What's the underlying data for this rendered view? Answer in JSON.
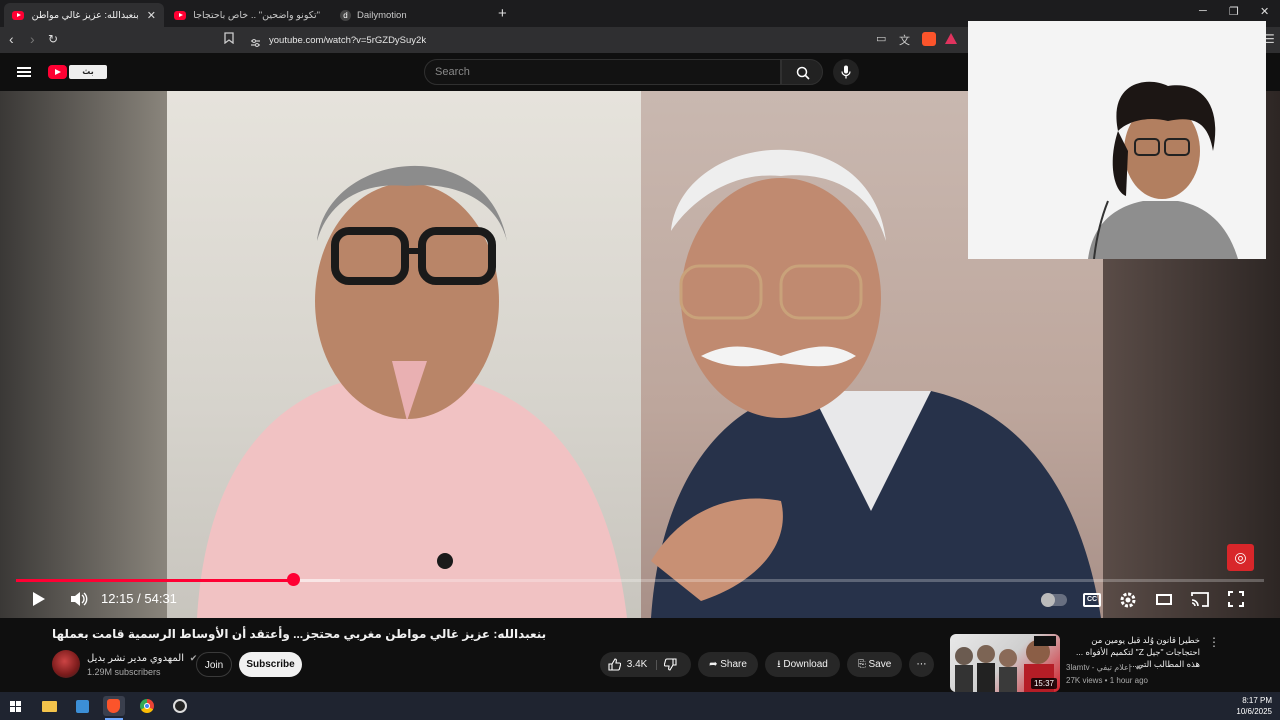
{
  "browser": {
    "tabs": [
      {
        "title": "بنعبدالله: عزيز غالي مواطن مغربي",
        "active": true,
        "site": "youtube"
      },
      {
        "title": "\"تكونو واضحين\" .. خاص باحتجاجات الشـ",
        "active": false,
        "site": "youtube"
      },
      {
        "title": "Dailymotion",
        "active": false,
        "site": "dailymotion"
      }
    ],
    "new_tab": "+",
    "url": "youtube.com/watch?v=5rGZDySuy2k"
  },
  "youtube": {
    "search_placeholder": "Search",
    "logo_badge": "بث",
    "player": {
      "time": "12:15 / 54:31",
      "progress": 0.2222,
      "buffered": 0.26
    },
    "video": {
      "title": "بنعبدالله: عزيز غالي مواطن مغربي محتجز... وأعتقد أن الأوساط الرسمية قامت بعملها",
      "channel": "المهدوي مدير نشر بديل",
      "subscribers": "1.29M subscribers",
      "join": "Join",
      "subscribe": "Subscribe",
      "likes": "3.4K",
      "share": "Share",
      "download": "Download",
      "save": "Save"
    },
    "recommended": {
      "title": "خطير| قانون وُلد قبل يومين من احتجاجات \"جيل Z\" لتكميم الأفواه ... هذه المطالب التي...",
      "channel": "3lamtv - إعلام تيفي",
      "meta": "27K views • 1 hour ago",
      "duration": "15:37"
    }
  },
  "taskbar": {
    "time": "8:17 PM",
    "date": "10/6/2025"
  },
  "colors": {
    "accent": "#ff0033",
    "background": "#0f0f0f"
  }
}
